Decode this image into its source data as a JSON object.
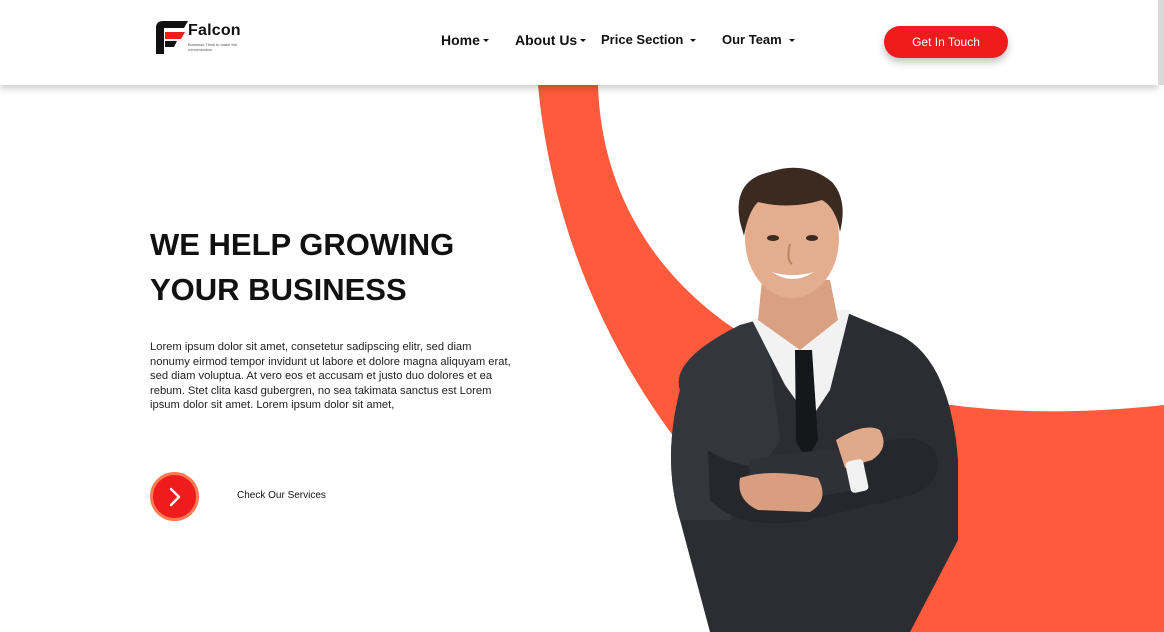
{
  "brand": {
    "name": "Falcon",
    "tagline": "Business Think to make the concentration",
    "logo_icon": "falcon-f-logo",
    "accent_color": "#ee1c1c",
    "swoosh_color": "#fd5b3b"
  },
  "nav": {
    "items": [
      {
        "label": "Home",
        "has_dropdown": true
      },
      {
        "label": "About Us",
        "has_dropdown": true
      },
      {
        "label": "Price Section",
        "has_dropdown": true
      },
      {
        "label": "Our Team",
        "has_dropdown": true
      }
    ],
    "cta_label": "Get In Touch"
  },
  "hero": {
    "title_line1": "WE HELP GROWING",
    "title_line2": "YOUR BUSINESS",
    "body": "Lorem ipsum dolor sit amet, consetetur sadipscing elitr, sed diam nonumy eirmod tempor invidunt ut labore et dolore magna aliquyam erat, sed diam voluptua. At vero eos et accusam et justo duo dolores et ea rebum. Stet clita kasd gubergren, no sea takimata sanctus est Lorem ipsum dolor sit amet. Lorem ipsum dolor sit amet,",
    "services_icon": "chevron-right-icon",
    "services_label": "Check Our Services"
  }
}
